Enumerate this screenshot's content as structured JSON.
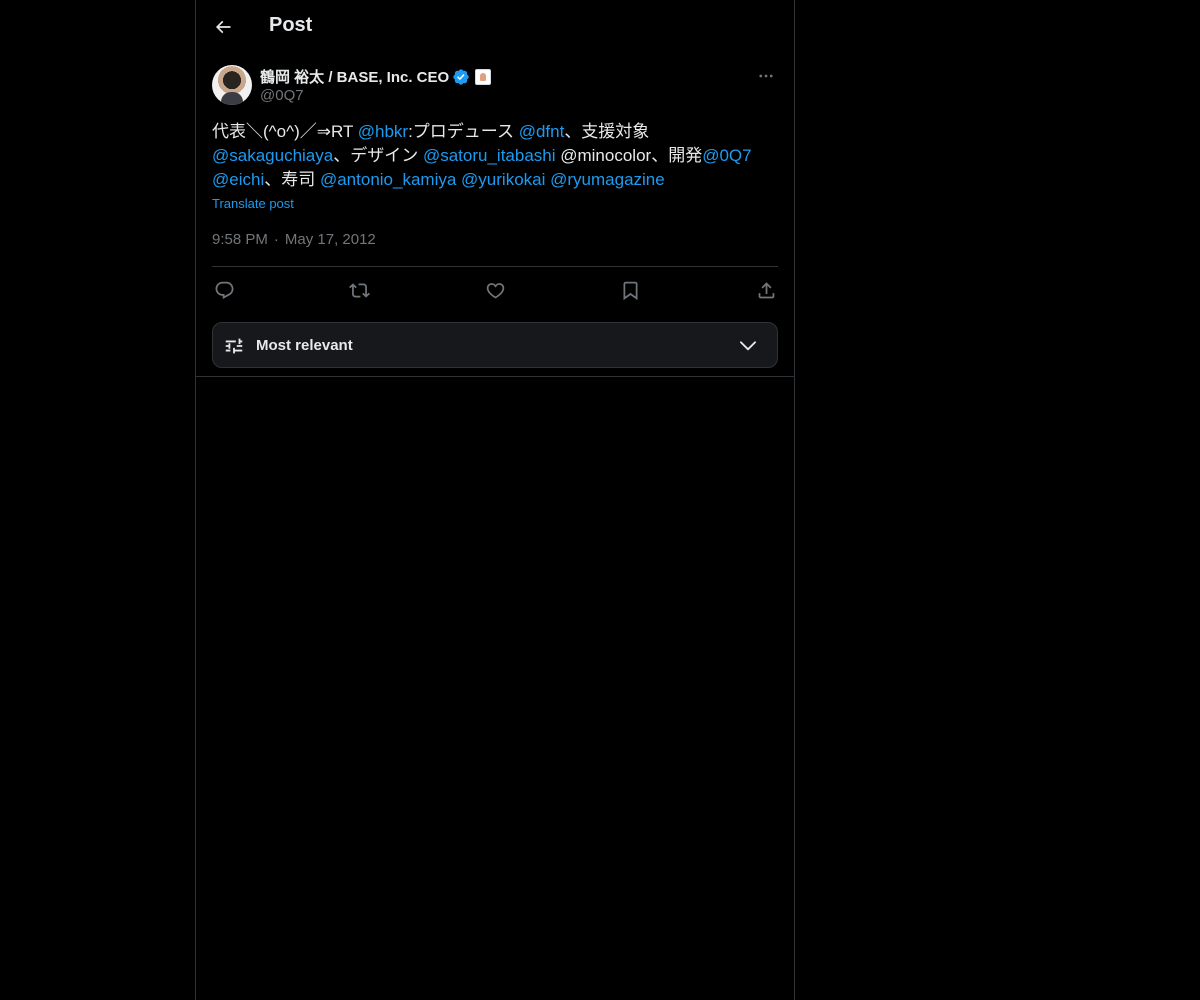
{
  "header": {
    "title": "Post",
    "back_icon": "arrow-left-icon"
  },
  "author": {
    "display_name": "鶴岡 裕太 / BASE, Inc. CEO",
    "handle": "@0Q7",
    "verified_color": "#1d9bf0"
  },
  "tweet": {
    "segments": [
      {
        "text": "代表＼(^o^)／⇒RT ",
        "type": "text"
      },
      {
        "text": "@hbkr",
        "type": "mention"
      },
      {
        "text": ":プロデュース ",
        "type": "text"
      },
      {
        "text": "@dfnt",
        "type": "mention"
      },
      {
        "text": "、支援対象 ",
        "type": "text"
      },
      {
        "text": "@sakaguchiaya",
        "type": "mention"
      },
      {
        "text": "、デザイン ",
        "type": "text"
      },
      {
        "text": "@satoru_itabashi",
        "type": "mention"
      },
      {
        "text": " @minocolor、開発",
        "type": "text"
      },
      {
        "text": "@0Q7",
        "type": "mention"
      },
      {
        "text": " ",
        "type": "text"
      },
      {
        "text": "@eichi",
        "type": "mention"
      },
      {
        "text": "、寿司 ",
        "type": "text"
      },
      {
        "text": "@antonio_kamiya",
        "type": "mention"
      },
      {
        "text": " ",
        "type": "text"
      },
      {
        "text": "@yurikokai",
        "type": "mention"
      },
      {
        "text": " ",
        "type": "text"
      },
      {
        "text": "@ryumagazine",
        "type": "mention"
      }
    ],
    "translate_label": "Translate post",
    "time": "9:58 PM",
    "separator": "·",
    "date": "May 17, 2012"
  },
  "actions": {
    "reply": "reply-icon",
    "repost": "repost-icon",
    "like": "heart-icon",
    "bookmark": "bookmark-icon",
    "share": "share-icon"
  },
  "sort": {
    "label": "Most relevant"
  },
  "colors": {
    "background": "#000000",
    "text": "#e7e9ea",
    "secondary": "#71767b",
    "accent": "#1d9bf0",
    "border": "#2f3336"
  }
}
